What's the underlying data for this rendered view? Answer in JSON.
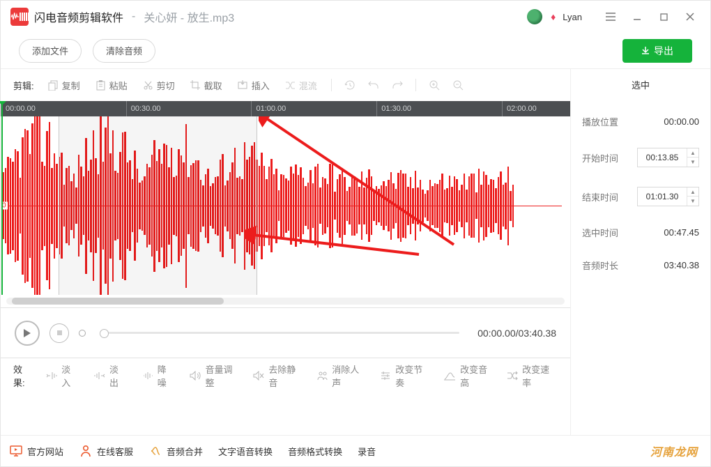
{
  "title": {
    "app": "闪电音频剪辑软件",
    "sep": " - ",
    "file": "关心妍 - 放生.mp3"
  },
  "user": {
    "name": "Lyan"
  },
  "top_actions": {
    "add_file": "添加文件",
    "clear_audio": "清除音频",
    "export": "导出"
  },
  "edit": {
    "label": "剪辑:",
    "tools": {
      "copy": "复制",
      "paste": "粘贴",
      "cut": "剪切",
      "crop": "截取",
      "insert": "插入",
      "mix": "混流"
    }
  },
  "timeline": {
    "ticks": [
      "00:00.00",
      "00:30.00",
      "01:00.00",
      "01:30.00",
      "02:00.00"
    ],
    "axis_label": "0",
    "scroll_thumb_width_pct": 38
  },
  "playback": {
    "current": "00:00.00",
    "total": "03:40.38"
  },
  "side": {
    "header": "选中",
    "play_pos_label": "播放位置",
    "play_pos": "00:00.00",
    "start_label": "开始时间",
    "start": "00:13.85",
    "end_label": "结束时间",
    "end": "01:01.30",
    "sel_label": "选中时间",
    "sel": "00:47.45",
    "dur_label": "音频时长",
    "dur": "03:40.38"
  },
  "effects": {
    "label": "效果:",
    "fade_in": "淡入",
    "fade_out": "淡出",
    "denoise": "降噪",
    "volume": "音量调整",
    "trim_silence": "去除静音",
    "remove_vocal": "消除人声",
    "tempo": "改变节奏",
    "pitch": "改变音高",
    "speed": "改变速率"
  },
  "footer": {
    "site": "官方网站",
    "support": "在线客服",
    "merge": "音频合并",
    "tts": "文字语音转换",
    "format": "音频格式转换",
    "record": "录音",
    "watermark": "河南龙网"
  }
}
